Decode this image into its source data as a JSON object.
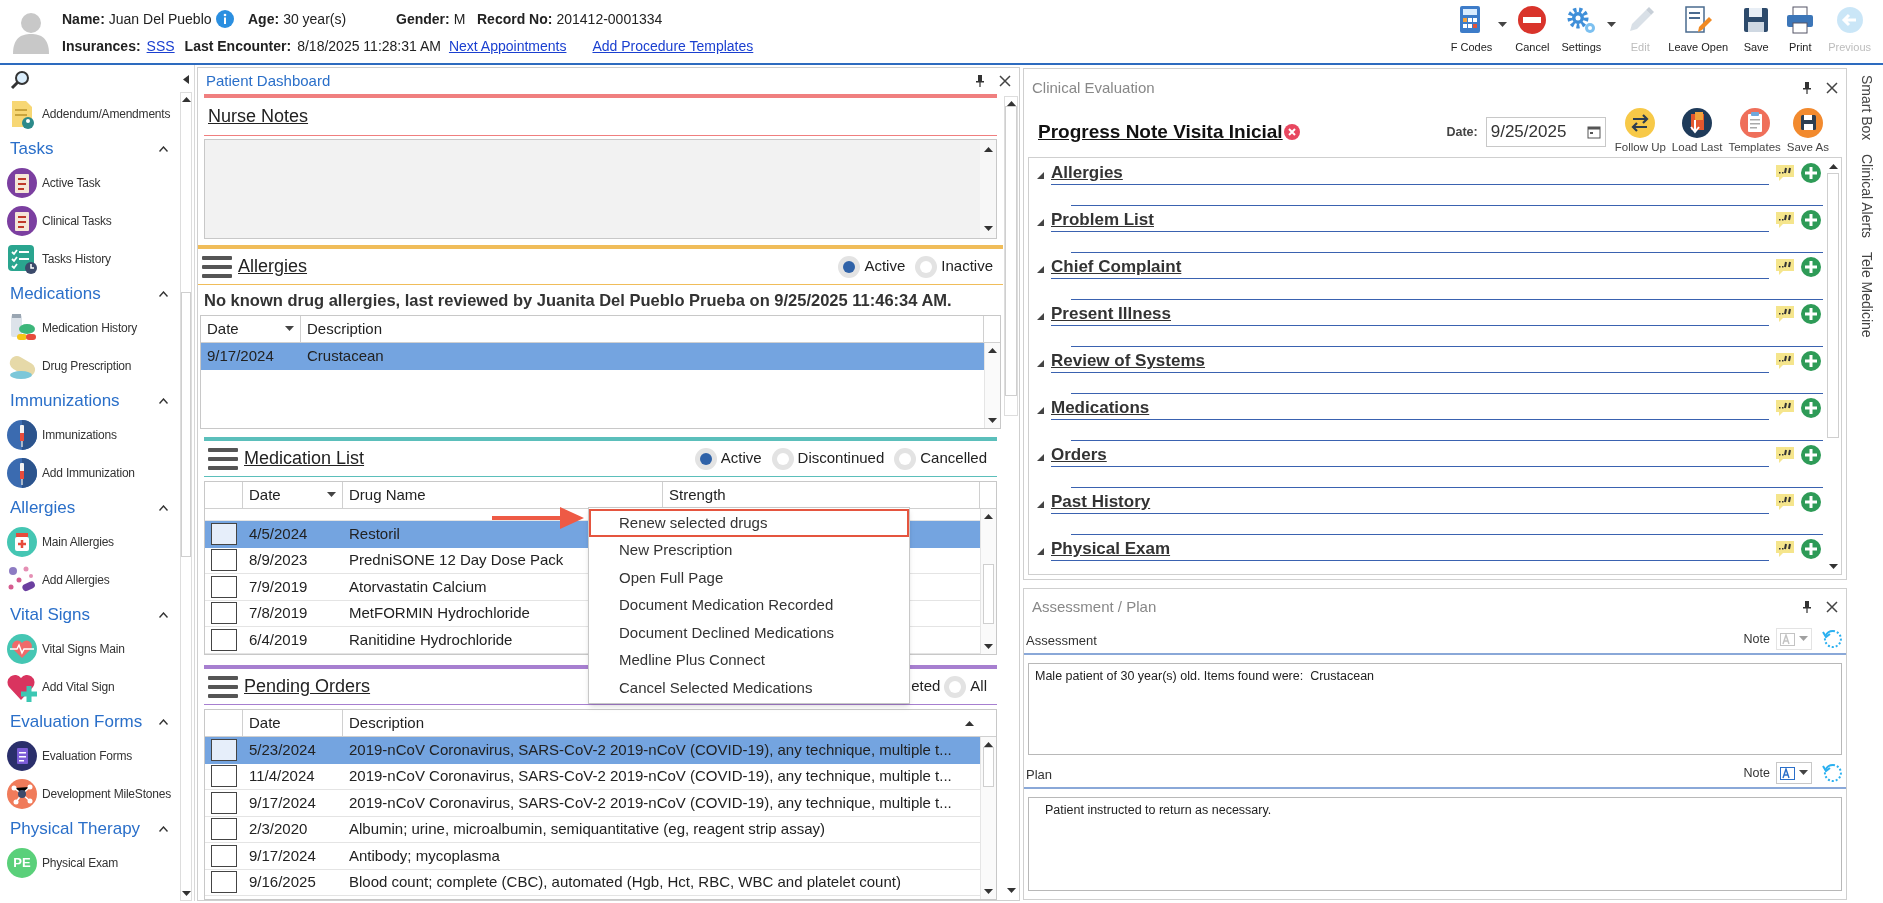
{
  "patient": {
    "fields": [
      {
        "label": "Name:",
        "value": "Juan Del Pueblo",
        "info": true
      },
      {
        "label": "Age:",
        "value": "30 year(s)",
        "info": false
      },
      {
        "label": "Gender:",
        "value": "M",
        "info": false
      },
      {
        "label": "Record No:",
        "value": "201412-0001334",
        "info": false
      }
    ],
    "insurances_label": "Insurances:",
    "insurance": "SSS",
    "last_encounter_label": "Last Encounter:",
    "last_encounter": "8/18/2025 11:28:31 AM",
    "links": [
      "Next Appointments",
      "Add Procedure Templates"
    ]
  },
  "toolbar": [
    {
      "label": "F Codes",
      "kind": "fcodes",
      "dropdown": true,
      "disabled": false
    },
    {
      "label": "Cancel",
      "kind": "cancel",
      "dropdown": false,
      "disabled": false
    },
    {
      "label": "Settings",
      "kind": "settings",
      "dropdown": true,
      "disabled": false
    },
    {
      "label": "Edit",
      "kind": "edit",
      "dropdown": false,
      "disabled": true
    },
    {
      "label": "Leave Open",
      "kind": "leave_open",
      "dropdown": false,
      "disabled": false
    },
    {
      "label": "Save",
      "kind": "save",
      "dropdown": false,
      "disabled": false
    },
    {
      "label": "Print",
      "kind": "print",
      "dropdown": false,
      "disabled": false
    },
    {
      "label": "Previous",
      "kind": "previous",
      "dropdown": false,
      "disabled": true
    }
  ],
  "sidebar": {
    "top_items": [
      {
        "label": "Addendum/Amendments",
        "kind": "addendum"
      }
    ],
    "groups": [
      {
        "title": "Tasks",
        "expanded": true,
        "items": [
          {
            "label": "Active Task",
            "kind": "task"
          },
          {
            "label": "Clinical Tasks",
            "kind": "task"
          },
          {
            "label": "Tasks History",
            "kind": "history"
          }
        ]
      },
      {
        "title": "Medications",
        "expanded": true,
        "items": [
          {
            "label": "Medication History",
            "kind": "pills"
          },
          {
            "label": "Drug Prescription",
            "kind": "capsule"
          }
        ]
      },
      {
        "title": "Immunizations",
        "expanded": true,
        "items": [
          {
            "label": "Immunizations",
            "kind": "syringe"
          },
          {
            "label": "Add Immunization",
            "kind": "syringe"
          }
        ]
      },
      {
        "title": "Allergies",
        "expanded": true,
        "items": [
          {
            "label": "Main Allergies",
            "kind": "bottle"
          },
          {
            "label": "Add Allergies",
            "kind": "dots"
          }
        ]
      },
      {
        "title": "Vital Signs",
        "expanded": true,
        "items": [
          {
            "label": "Vital Signs Main",
            "kind": "heartbeat"
          },
          {
            "label": "Add Vital Sign",
            "kind": "heart_plus"
          }
        ]
      },
      {
        "title": "Evaluation Forms",
        "expanded": true,
        "items": [
          {
            "label": "Evaluation Forms",
            "kind": "form"
          },
          {
            "label": "Development MileStones",
            "kind": "network"
          }
        ]
      },
      {
        "title": "Physical Therapy",
        "expanded": true,
        "items": [
          {
            "label": "Physical Exam",
            "kind": "initials",
            "initials": "PE"
          }
        ]
      }
    ]
  },
  "dashboard": {
    "title": "Patient Dashboard",
    "nurse_notes": {
      "title": "Nurse Notes"
    },
    "allergies": {
      "title": "Allergies",
      "filters": [
        {
          "label": "Active",
          "selected": true
        },
        {
          "label": "Inactive",
          "selected": false
        }
      ],
      "message": "No known drug allergies, last reviewed by Juanita Del Pueblo Prueba on 9/25/2025 11:46:34 AM.",
      "columns": [
        "Date",
        "Description"
      ],
      "rows": [
        {
          "cells": [
            "9/17/2024",
            "Crustacean"
          ],
          "selected": true
        }
      ]
    },
    "medication_list": {
      "title": "Medication List",
      "filters": [
        {
          "label": "Active",
          "selected": true
        },
        {
          "label": "Discontinued",
          "selected": false
        },
        {
          "label": "Cancelled",
          "selected": false
        }
      ],
      "columns": [
        "Date",
        "Drug Name",
        "Strength"
      ],
      "rows": [
        {
          "cells": [
            "4/5/2024",
            "Restoril"
          ],
          "selected": true,
          "checked": false
        },
        {
          "cells": [
            "8/9/2023",
            "PredniSONE 12 Day Dose Pack"
          ],
          "selected": false,
          "checked": false
        },
        {
          "cells": [
            "7/9/2019",
            "Atorvastatin Calcium"
          ],
          "selected": false,
          "checked": false
        },
        {
          "cells": [
            "7/8/2019",
            "MetFORMIN Hydrochloride"
          ],
          "selected": false,
          "checked": false
        },
        {
          "cells": [
            "6/4/2019",
            "Ranitidine Hydrochloride"
          ],
          "selected": false,
          "checked": false
        }
      ]
    },
    "pending_orders": {
      "title": "Pending Orders",
      "filter_fragment": "eted",
      "filters": [
        {
          "label": "All",
          "selected": false
        }
      ],
      "columns": [
        "Date",
        "Description"
      ],
      "rows": [
        {
          "cells": [
            "5/23/2024",
            "2019-nCoV Coronavirus, SARS-CoV-2 2019-nCoV (COVID-19), any technique, multiple t..."
          ],
          "selected": true,
          "checked": false
        },
        {
          "cells": [
            "11/4/2024",
            "2019-nCoV Coronavirus, SARS-CoV-2 2019-nCoV (COVID-19), any technique, multiple t..."
          ],
          "selected": false,
          "checked": false
        },
        {
          "cells": [
            "9/17/2024",
            "2019-nCoV Coronavirus, SARS-CoV-2 2019-nCoV (COVID-19), any technique, multiple t..."
          ],
          "selected": false,
          "checked": false
        },
        {
          "cells": [
            "2/3/2020",
            "Albumin; urine, microalbumin, semiquantitative (eg, reagent strip assay)"
          ],
          "selected": false,
          "checked": false
        },
        {
          "cells": [
            "9/17/2024",
            "Antibody; mycoplasma"
          ],
          "selected": false,
          "checked": false
        },
        {
          "cells": [
            "9/16/2025",
            "Blood count; complete (CBC), automated (Hgb, Hct, RBC, WBC and platelet count)"
          ],
          "selected": false,
          "checked": false
        }
      ]
    }
  },
  "context_menu": {
    "items": [
      {
        "label": "Renew selected drugs",
        "selected": true
      },
      {
        "label": "New Prescription",
        "selected": false
      },
      {
        "label": "Open Full Page",
        "selected": false
      },
      {
        "label": "Document Medication Recorded",
        "selected": false
      },
      {
        "label": "Document Declined Medications",
        "selected": false
      },
      {
        "label": "Medline Plus Connect",
        "selected": false
      },
      {
        "label": "Cancel Selected Medications",
        "selected": false
      }
    ]
  },
  "clinical": {
    "title": "Clinical Evaluation",
    "note_title": "Progress Note Visita Inicial",
    "date_label": "Date:",
    "date": "9/25/2025",
    "actions": [
      {
        "label": "Follow Up",
        "kind": "follow_up"
      },
      {
        "label": "Load Last",
        "kind": "load_last"
      },
      {
        "label": "Templates",
        "kind": "templates"
      },
      {
        "label": "Save As",
        "kind": "save_as"
      }
    ],
    "sections": [
      {
        "title": "Allergies",
        "expanded": true
      },
      {
        "title": "Problem List",
        "expanded": true
      },
      {
        "title": "Chief Complaint",
        "expanded": true
      },
      {
        "title": "Present Illness",
        "expanded": true
      },
      {
        "title": "Review of Systems",
        "expanded": true
      },
      {
        "title": "Medications",
        "expanded": true
      },
      {
        "title": "Orders",
        "expanded": true
      },
      {
        "title": "Past History",
        "expanded": true
      },
      {
        "title": "Physical Exam",
        "expanded": true
      }
    ]
  },
  "assessment_plan": {
    "title": "Assessment / Plan",
    "parts": [
      {
        "label": "Assessment",
        "note_label": "Note",
        "note_enabled": false,
        "text": "Male patient of 30 year(s) old. Items found were:  Crustacean"
      },
      {
        "label": "Plan",
        "note_label": "Note",
        "note_enabled": true,
        "text": "Patient instructed to return as necessary."
      }
    ]
  },
  "side_tabs": [
    "Smart Box",
    "Clinical Alerts",
    "Tele Medicine"
  ]
}
